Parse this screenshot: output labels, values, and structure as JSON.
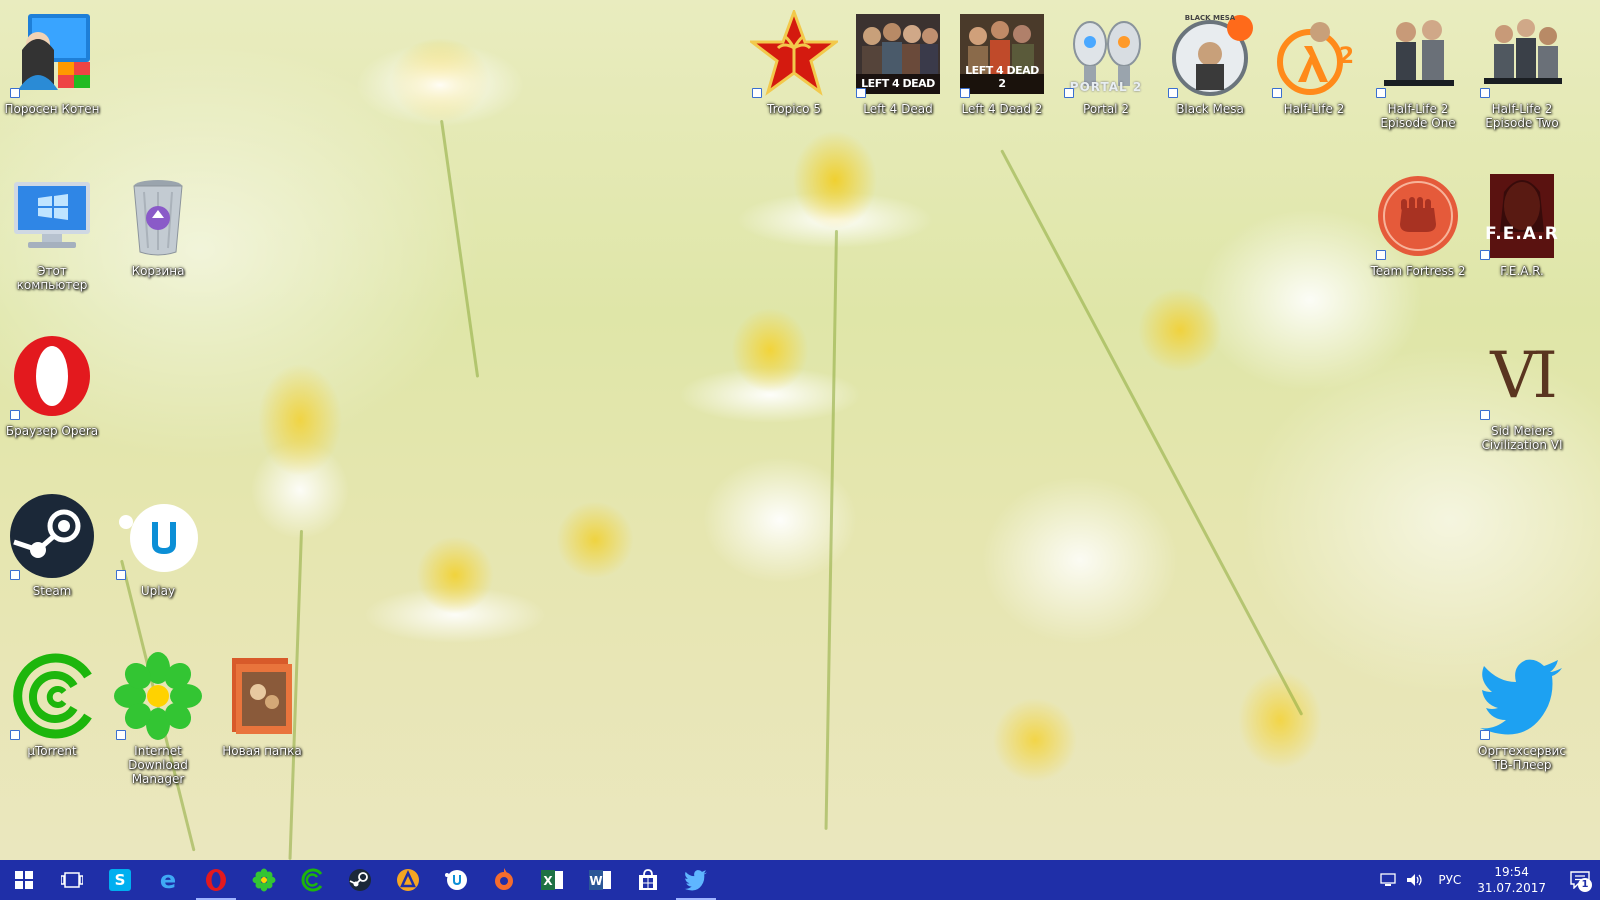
{
  "desktop": {
    "icons": [
      {
        "id": "user",
        "label": "Поросен Котен"
      },
      {
        "id": "computer",
        "label": "Этот компьютер"
      },
      {
        "id": "recycle",
        "label": "Корзина"
      },
      {
        "id": "opera",
        "label": "Браузер Opera"
      },
      {
        "id": "steam",
        "label": "Steam"
      },
      {
        "id": "uplay",
        "label": "Uplay"
      },
      {
        "id": "utorrent",
        "label": "µTorrent"
      },
      {
        "id": "idm",
        "label": "Internet Download Manager"
      },
      {
        "id": "folder",
        "label": "Новая папка"
      },
      {
        "id": "tropico",
        "label": "Tropico 5"
      },
      {
        "id": "l4d",
        "label": "Left 4 Dead",
        "tile_text": "LEFT 4 DEAD"
      },
      {
        "id": "l4d2",
        "label": "Left 4 Dead 2",
        "tile_text": "LEFT 4 DEAD 2"
      },
      {
        "id": "portal2",
        "label": "Portal 2",
        "tile_text": "PORTAL 2"
      },
      {
        "id": "blackmesa",
        "label": "Black Mesa",
        "tile_text": "BLACK MESA"
      },
      {
        "id": "hl2",
        "label": "Half-Life 2",
        "tile_text": "2"
      },
      {
        "id": "hl2ep1",
        "label": "Half-Life 2 Episode One"
      },
      {
        "id": "hl2ep2",
        "label": "Half-Life 2 Episode Two"
      },
      {
        "id": "tf2",
        "label": "Team Fortress 2"
      },
      {
        "id": "fear",
        "label": "F.E.A.R.",
        "tile_text": "F.E.A.R"
      },
      {
        "id": "civ6",
        "label": "Sid Meiers Civilization VI",
        "tile_text": "VI"
      },
      {
        "id": "twitter",
        "label": "Оргтехсервис ТВ-Плеер"
      }
    ]
  },
  "taskbar": {
    "pinned": [
      "start",
      "task-view",
      "skype",
      "edge",
      "opera",
      "icq",
      "utorrent",
      "steam",
      "avast",
      "uplay",
      "origin",
      "excel",
      "word",
      "store",
      "twitter"
    ],
    "tray": {
      "language": "РУС",
      "time": "19:54",
      "date": "31.07.2017",
      "notifications": "1"
    }
  },
  "colors": {
    "taskbar": "#1f2fa8",
    "accent": "#9fb4ff"
  }
}
